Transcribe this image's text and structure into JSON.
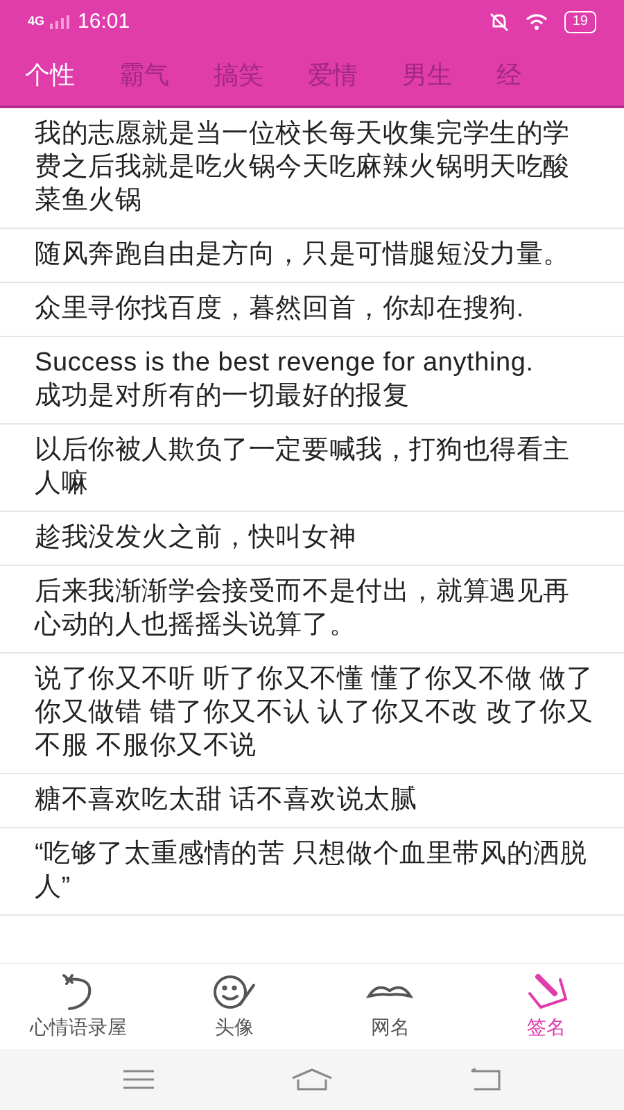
{
  "status_bar": {
    "network": "4G",
    "time": "16:01",
    "battery": "19"
  },
  "tabs": [
    {
      "label": "个性",
      "selected": true
    },
    {
      "label": "霸气",
      "selected": false
    },
    {
      "label": "搞笑",
      "selected": false
    },
    {
      "label": "爱情",
      "selected": false
    },
    {
      "label": "男生",
      "selected": false
    },
    {
      "label": "经",
      "selected": false
    }
  ],
  "quotes": [
    "我的志愿就是当一位校长每天收集完学生的学费之后我就是吃火锅今天吃麻辣火锅明天吃酸菜鱼火锅",
    "随风奔跑自由是方向，只是可惜腿短没力量。",
    "众里寻你找百度，暮然回首，你却在搜狗.",
    "Success is the best revenge for anything.\n成功是对所有的一切最好的报复",
    "以后你被人欺负了一定要喊我，打狗也得看主人嘛",
    "趁我没发火之前，快叫女神",
    "后来我渐渐学会接受而不是付出，就算遇见再心动的人也摇摇头说算了。",
    "说了你又不听 听了你又不懂 懂了你又不做 做了你又做错 错了你又不认 认了你又不改 改了你又不服 不服你又不说",
    "糖不喜欢吃太甜 话不喜欢说太腻",
    "“吃够了太重感情的苦 只想做个血里带风的洒脱人”"
  ],
  "bottom_nav": [
    {
      "label": "心情语录屋",
      "kind": "plane",
      "selected": false
    },
    {
      "label": "头像",
      "kind": "face",
      "selected": false
    },
    {
      "label": "网名",
      "kind": "mustache",
      "selected": false
    },
    {
      "label": "签名",
      "kind": "sign",
      "selected": true
    }
  ]
}
